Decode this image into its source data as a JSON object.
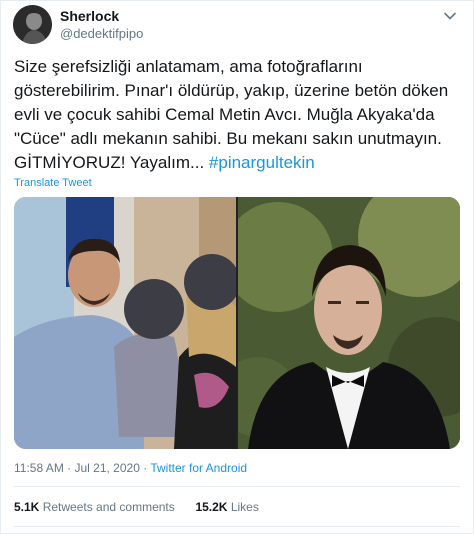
{
  "author": {
    "name": "Sherlock",
    "handle": "@dedektifpipo"
  },
  "tweet": {
    "text": "Size şerefsizliği anlatamam, ama fotoğraflarını gösterebilirim. Pınar'ı öldürüp, yakıp, üzerine betön döken evli ve çocuk sahibi Cemal Metin Avcı. Muğla Akyaka'da \"Cüce\" adlı mekanın sahibi. Bu mekanı sakın unutmayın. GİTMİYORUZ! Yayalım... ",
    "hashtag": "#pinargultekin",
    "translate_label": "Translate Tweet"
  },
  "meta": {
    "time": "11:58 AM",
    "separator1": " · ",
    "date": "Jul 21, 2020",
    "separator2": " · ",
    "source": "Twitter for Android"
  },
  "stats": {
    "retweets_count": "5.1K",
    "retweets_label": "Retweets and comments",
    "likes_count": "15.2K",
    "likes_label": "Likes"
  },
  "colors": {
    "accent": "#1b95e0",
    "muted": "#657786",
    "text": "#14171a"
  },
  "icons": {
    "menu": "chevron-down-icon"
  }
}
